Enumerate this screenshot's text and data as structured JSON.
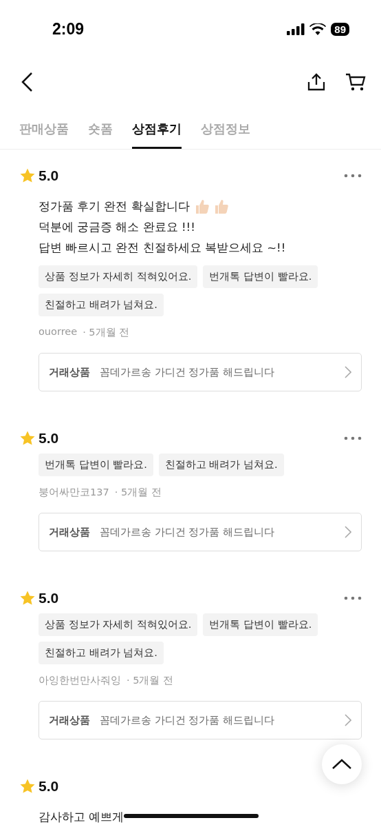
{
  "status_bar": {
    "time": "2:09",
    "battery": "89"
  },
  "tabs": [
    {
      "label": "판매상품",
      "selected": false
    },
    {
      "label": "숏폼",
      "selected": false
    },
    {
      "label": "상점후기",
      "selected": true
    },
    {
      "label": "상점정보",
      "selected": false
    }
  ],
  "reviews": [
    {
      "rating": "5.0",
      "lines": [
        "정가품 후기 완전 확실합니다",
        "덕분에 궁금증 해소 완료요 !!!",
        "답변 빠르시고 완전 친절하세요 복받으세요 ~!!"
      ],
      "thumbs": true,
      "tags": [
        "상품 정보가 자세히 적혀있어요.",
        "번개톡 답변이 빨라요.",
        "친절하고 배려가 넘쳐요."
      ],
      "author": "ouorree",
      "time": "· 5개월 전",
      "product_label": "거래상품",
      "product": "꼼데가르송 가디건 정가품 해드립니다"
    },
    {
      "rating": "5.0",
      "tags": [
        "번개톡 답변이 빨라요.",
        "친절하고 배려가 넘쳐요."
      ],
      "author": "붕어싸만코137",
      "time": "· 5개월 전",
      "product_label": "거래상품",
      "product": "꼼데가르송 가디건 정가품 해드립니다"
    },
    {
      "rating": "5.0",
      "tags": [
        "상품 정보가 자세히 적혀있어요.",
        "번개톡 답변이 빨라요.",
        "친절하고 배려가 넘쳐요."
      ],
      "author": "아잉한번만사줘잉",
      "time": "· 5개월 전",
      "product_label": "거래상품",
      "product": "꼼데가르송 가디건 정가품 해드립니다"
    },
    {
      "rating": "5.0",
      "lines": [
        "감사하고 예쁘게"
      ]
    }
  ]
}
